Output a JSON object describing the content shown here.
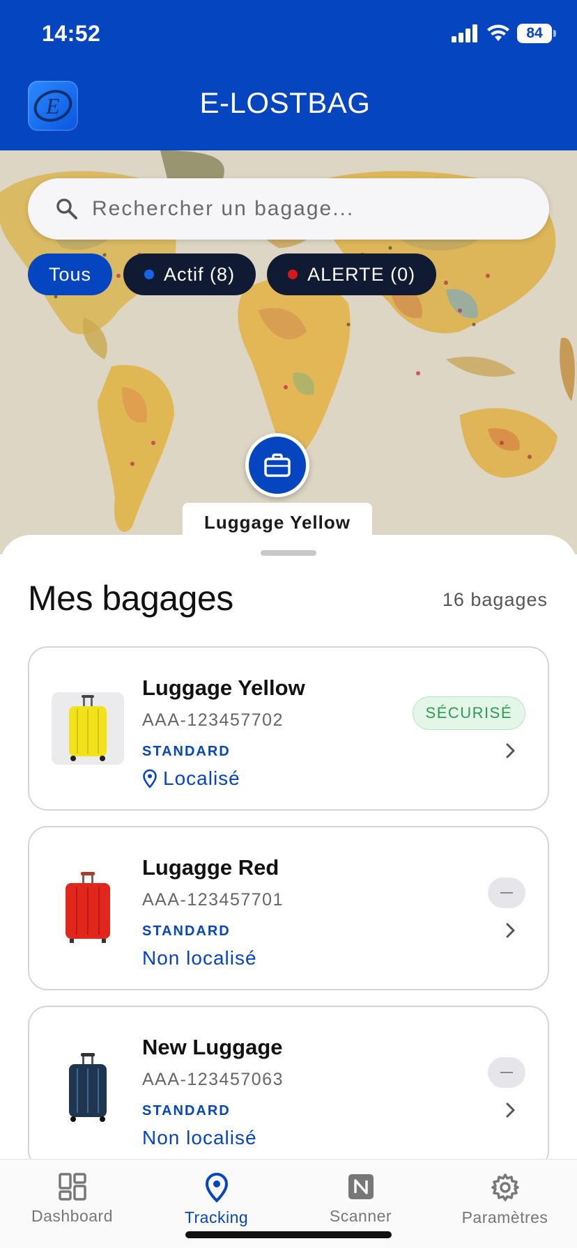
{
  "status_bar": {
    "time": "14:52",
    "battery": "84"
  },
  "header": {
    "title": "E-LOSTBAG",
    "logo_letter": "E"
  },
  "search": {
    "placeholder": "Rechercher un bagage..."
  },
  "filters": [
    {
      "label": "Tous",
      "active": true
    },
    {
      "label": "Actif (8)",
      "dot_color": "#1366e6"
    },
    {
      "label": "ALERTE (0)",
      "dot_color": "#d11a1a"
    }
  ],
  "map": {
    "marker_label": "Luggage Yellow"
  },
  "sheet": {
    "title": "Mes bagages",
    "count": "16 bagages"
  },
  "bags": [
    {
      "name": "Luggage Yellow",
      "code": "AAA-123457702",
      "tier": "STANDARD",
      "location": "Localisé",
      "status": "SÉCURISÉ",
      "color": "#f2e21c"
    },
    {
      "name": "Lugagge Red",
      "code": "AAA-123457701",
      "tier": "STANDARD",
      "location": "Non localisé",
      "status": "",
      "color": "#e1261c"
    },
    {
      "name": "New Luggage",
      "code": "AAA-123457063",
      "tier": "STANDARD",
      "location": "Non localisé",
      "status": "",
      "color": "#1f3550"
    }
  ],
  "tabs": [
    {
      "label": "Dashboard",
      "icon": "dashboard-icon"
    },
    {
      "label": "Tracking",
      "icon": "location-pin-icon",
      "active": true
    },
    {
      "label": "Scanner",
      "icon": "nfc-icon"
    },
    {
      "label": "Paramètres",
      "icon": "gear-icon"
    }
  ],
  "colors": {
    "primary": "#0546c0",
    "dark_chip": "#101b33",
    "secure_green": "#2e9a55"
  }
}
